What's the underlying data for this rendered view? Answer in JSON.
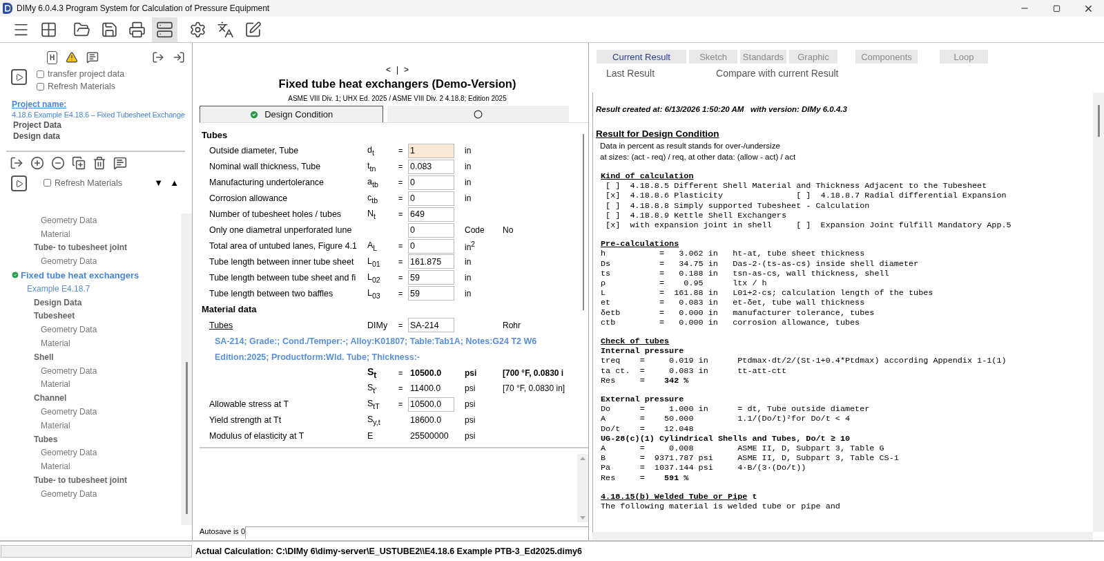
{
  "window": {
    "title": "DIMy 6.0.4.3 Program System for Calculation of Pressure Equipment"
  },
  "toolbar": {
    "buttons": [
      {
        "selected": false
      },
      {
        "selected": false
      },
      {
        "selected": false
      },
      {
        "selected": false
      },
      {
        "selected": false
      },
      {
        "selected": true
      },
      {
        "selected": false
      },
      {
        "selected": false
      },
      {
        "selected": false
      }
    ]
  },
  "left_panel": {
    "help_label": "H",
    "project_options": [
      {
        "label": "transfer project data",
        "checked": false
      },
      {
        "label": "Refresh Materials",
        "checked": false
      }
    ],
    "project_name_label": "Project name:",
    "project_title": "4.18.6 Example E4.18.6 – Fixed Tubesheet Exchange",
    "project_items": [
      "Project Data",
      "Design data"
    ],
    "refresh_option": {
      "label": "Refresh Materials",
      "checked": false
    },
    "sort_down": "▼",
    "sort_up": "▲",
    "tree": [
      {
        "label": "Geometry Data",
        "kind": "leaf"
      },
      {
        "label": "Material",
        "kind": "leaf"
      },
      {
        "label": "Tube- to tubesheet joint",
        "kind": "group",
        "children": [
          {
            "label": "Geometry Data",
            "kind": "leaf"
          }
        ]
      },
      {
        "label": "Fixed tube heat exchangers",
        "kind": "root",
        "children": [
          {
            "label": "Example E4.18.7",
            "kind": "example",
            "children": [
              {
                "label": "Design Data",
                "kind": "group"
              },
              {
                "label": "Tubesheet",
                "kind": "group",
                "children": [
                  {
                    "label": "Geometry Data",
                    "kind": "leaf"
                  },
                  {
                    "label": "Material",
                    "kind": "leaf"
                  }
                ]
              },
              {
                "label": "Shell",
                "kind": "group",
                "children": [
                  {
                    "label": "Geometry Data",
                    "kind": "leaf"
                  },
                  {
                    "label": "Material",
                    "kind": "leaf"
                  }
                ]
              },
              {
                "label": "Channel",
                "kind": "group",
                "children": [
                  {
                    "label": "Geometry Data",
                    "kind": "leaf"
                  },
                  {
                    "label": "Material",
                    "kind": "leaf"
                  }
                ]
              },
              {
                "label": "Tubes",
                "kind": "group",
                "children": [
                  {
                    "label": "Geometry Data",
                    "kind": "leaf"
                  },
                  {
                    "label": "Material",
                    "kind": "leaf"
                  }
                ]
              },
              {
                "label": "Tube- to tubesheet joint",
                "kind": "group",
                "children": [
                  {
                    "label": "Geometry Data",
                    "kind": "leaf"
                  }
                ]
              }
            ]
          }
        ]
      }
    ]
  },
  "editor": {
    "nav": {
      "prev": "<",
      "separator": "|",
      "next": ">"
    },
    "title": "Fixed tube heat exchangers (Demo-Version)",
    "subtitle": "ASME VIII Div. 1; UHX Ed. 2025 / ASME VIII Div. 2 4.18.8; Edition 2025",
    "tabs": [
      {
        "label": "Design Condition",
        "selected": true,
        "done": true
      },
      {
        "selected": false,
        "done": false
      }
    ],
    "sections": [
      {
        "title": "Tubes",
        "rows": [
          {
            "kind": "field",
            "label": "Outside diameter, Tube",
            "symbol": "d$_{t}$",
            "eq": "=",
            "value": "1",
            "unit": "in",
            "highlighted": true
          },
          {
            "kind": "field",
            "label": "Nominal wall thickness, Tube",
            "symbol": "t$_{tn}$",
            "eq": "=",
            "value": "0.083",
            "unit": "in",
            "highlighted": false
          },
          {
            "kind": "field",
            "label": "Manufacturing undertolerance",
            "symbol": "a$_{tb}$",
            "eq": "=",
            "value": "0",
            "unit": "in",
            "highlighted": false
          },
          {
            "kind": "field",
            "label": "Corrosion allowance",
            "symbol": "c$_{tb}$",
            "eq": "=",
            "value": "0",
            "unit": "in",
            "highlighted": false
          },
          {
            "kind": "field",
            "label": "Number of tubesheet holes / tubes",
            "symbol": "N$_{t}$",
            "eq": "=",
            "value": "649",
            "highlighted": false
          },
          {
            "kind": "field",
            "label": "Only one diametral unperforated lune",
            "value": "0",
            "unit": "Code",
            "note": "No",
            "highlighted": false
          },
          {
            "kind": "field",
            "label": "Total area of untubed lanes, Figure 4.1",
            "symbol": "A$_{L}$",
            "eq": "=",
            "value": "0",
            "unit": "in$^{2}$",
            "highlighted": false
          },
          {
            "kind": "field",
            "label": "Tube length between inner tube sheet",
            "symbol": "L$_{01}$",
            "eq": "=",
            "value": "161.875",
            "unit": "in",
            "highlighted": false
          },
          {
            "kind": "field",
            "label": "Tube length between tube sheet and fi",
            "symbol": "L$_{02}$",
            "eq": "=",
            "value": "59",
            "unit": "in",
            "highlighted": false
          },
          {
            "kind": "field",
            "label": "Tube length between two baffles",
            "symbol": "L$_{03}$",
            "eq": "=",
            "value": "59",
            "unit": "in",
            "highlighted": false
          }
        ]
      },
      {
        "title": "Material data",
        "rows": [
          {
            "kind": "link",
            "label": "Tubes",
            "symbol": "DIMy",
            "eq": "=",
            "value": "SA-214",
            "note": "Rohr",
            "highlighted": false
          },
          {
            "kind": "description",
            "label": "SA-214; Grade:; Cond./Temper:-; Alloy:K01807; Table:Tab1A; Notes:G24 T2 W6"
          },
          {
            "kind": "description",
            "label": "Edition:2025; Productform:Wld. Tube; Thickness:-"
          },
          {
            "kind": "strong",
            "symbol": "S$_{t}$",
            "eq": "=",
            "value": "10500.0",
            "unit": "psi",
            "note": "[700 °F, 0.0830 i"
          },
          {
            "kind": "value",
            "symbol": "S$_{t'}$",
            "eq": "=",
            "value": "11400.0",
            "unit": "psi",
            "note": "[70 °F, 0.0830 in]"
          },
          {
            "kind": "field",
            "label": "Allowable stress at T",
            "symbol": "S$_{tT}$",
            "eq": "=",
            "value": "10500.0",
            "unit": "psi",
            "highlighted": false
          },
          {
            "kind": "value",
            "label": "Yield strength at Tt",
            "symbol": "S$_{y,t}$",
            "value": "18600.0",
            "unit": "psi"
          },
          {
            "kind": "value",
            "label": "Modulus of elasticity at T",
            "symbol": "E",
            "value": "25500000",
            "unit": "psi"
          }
        ]
      }
    ],
    "autosave": "Autosave is 0"
  },
  "result_panel": {
    "tabs": [
      {
        "label": "Current Result",
        "selected": true
      },
      {
        "label": "Sketch",
        "selected": false
      },
      {
        "label": "Standards",
        "selected": false
      },
      {
        "label": "Graphic",
        "selected": false
      },
      {
        "label": "Components",
        "selected": false
      },
      {
        "label": "Loop",
        "selected": false
      }
    ],
    "links": [
      "Last Result",
      "Compare with current Result"
    ],
    "report": [
      {
        "kind": "meta",
        "text": "Result created at: 6/13/2026 1:50:20 AM   with version: DIMy 6.0.4.3"
      },
      {
        "kind": "title",
        "text": "Result for Design Condition"
      },
      {
        "kind": "note",
        "text": "Data in percent as result stands for over-/undersize"
      },
      {
        "kind": "note",
        "text": "at sizes: (act - req) / req, at other data: (allow - act) / act"
      },
      {
        "kind": "heading",
        "text": "Kind of calculation",
        "space_before": true
      },
      {
        "kind": "line",
        "text": " [ ]  4.18.8.5 Different Shell Material and Thickness Adjacent to the Tubesheet"
      },
      {
        "kind": "line",
        "text": " [x]  4.18.8.6 Plasticity               [ ]  4.18.8.7 Radial differential Expansion"
      },
      {
        "kind": "line",
        "text": " [ ]  4.18.8.8 Simply supported Tubesheet - Calculation"
      },
      {
        "kind": "line",
        "text": " [ ]  4.18.8.9 Kettle Shell Exchangers"
      },
      {
        "kind": "line",
        "text": " [x]  with expansion joint in shell     [ ]  Expansion Joint fulfill Mandatory App.5"
      },
      {
        "kind": "heading",
        "text": "Pre-calculations",
        "space_before": true
      },
      {
        "kind": "line",
        "text": "h           =   3.062 in   ht-at, tube sheet thickness"
      },
      {
        "kind": "line",
        "text": "Ds          =   34.75 in   Das-2·(ts-as-cs) inside shell diameter"
      },
      {
        "kind": "line",
        "text": "ts          =   0.188 in   tsn-as-cs, wall thickness, shell"
      },
      {
        "kind": "line",
        "text": "ρ           =    0.95      ltx / h"
      },
      {
        "kind": "line",
        "text": "L           =  161.88 in   L01+2·cs; calculation length of the tubes"
      },
      {
        "kind": "line",
        "text": "et          =   0.083 in   et-δet, tube wall thickness"
      },
      {
        "kind": "line",
        "text": "δetb        =   0.000 in   manufacturer tolerance, tubes"
      },
      {
        "kind": "line",
        "text": "ctb         =   0.000 in   corrosion allowance, tubes"
      },
      {
        "kind": "heading",
        "text": "Check of tubes",
        "space_before": true
      },
      {
        "kind": "sub",
        "text": "Internal pressure"
      },
      {
        "kind": "line",
        "text": "treq    =     0.019 in      Ptdmax·dt/2/(St·1+0.4*Ptdmax) according Appendix 1-1(1)"
      },
      {
        "kind": "line",
        "text": "ta ct.  =     0.083 in      tt-att-ctt"
      },
      {
        "kind": "line",
        "text": "Res     =    **342 %**"
      },
      {
        "kind": "sub",
        "text": "External pressure",
        "space_before": true
      },
      {
        "kind": "line",
        "text": "Do      =     1.000 in      = dt, Tube outside diameter"
      },
      {
        "kind": "line",
        "text": "A       =    50.000         1.1/(Do/t)²for Do/t < 4"
      },
      {
        "kind": "line",
        "text": "Do/t    =    12.048"
      },
      {
        "kind": "sub",
        "text": "UG-28(c)(1) Cylindrical Shells and Tubes, Do/t ≥ 10"
      },
      {
        "kind": "line",
        "text": "A       =     0.008         ASME II, D, Subpart 3, Table G"
      },
      {
        "kind": "line",
        "text": "B       =  9371.787 psi     ASME II, D, Subpart 3, Table CS-1"
      },
      {
        "kind": "line",
        "text": "Pa      =  1037.144 psi     4·B/(3·(Do/t))"
      },
      {
        "kind": "line",
        "text": "Res     =    **591 %**"
      },
      {
        "kind": "heading",
        "text": "4.18.15(b) Welded Tube or Pipe",
        "tail": " t",
        "space_before": true
      },
      {
        "kind": "line",
        "text": "The following material is welded tube or pipe and"
      }
    ]
  },
  "status_bar": {
    "text": "Actual Calculation: C:\\DIMy 6\\dimy-server\\E_USTUBE2\\\\E4.18.6 Example PTB-3_Ed2025.dimy6"
  }
}
